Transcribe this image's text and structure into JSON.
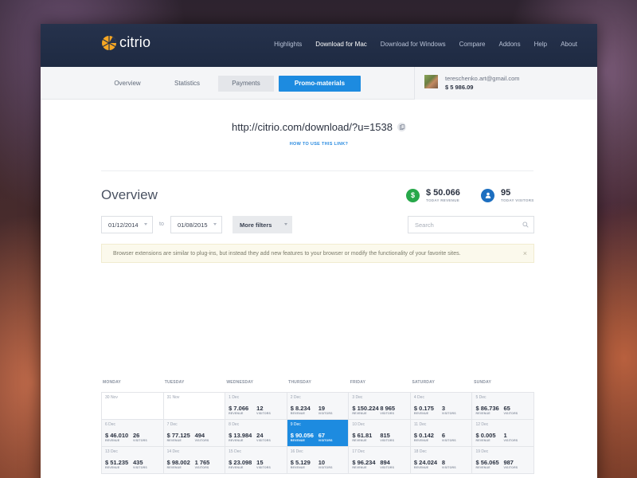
{
  "brand": {
    "name": "citrio",
    "logo_color": "#f5a623"
  },
  "nav": {
    "items": [
      {
        "label": "Highlights",
        "active": false
      },
      {
        "label": "Download for Mac",
        "active": true
      },
      {
        "label": "Download for Windows",
        "active": false
      },
      {
        "label": "Compare",
        "active": false
      },
      {
        "label": "Addons",
        "active": false
      },
      {
        "label": "Help",
        "active": false
      },
      {
        "label": "About",
        "active": false
      }
    ]
  },
  "tabs": [
    {
      "label": "Overview"
    },
    {
      "label": "Statistics"
    },
    {
      "label": "Payments"
    },
    {
      "label": "Promo-materials",
      "active": true
    }
  ],
  "account": {
    "email": "tereschenko.art@gmail.com",
    "balance": "$ 5 986.09"
  },
  "referral": {
    "link": "http://citrio.com/download/?u=1538",
    "howto": "HOW TO USE THIS LINK?"
  },
  "overview": {
    "title": "Overview",
    "revenue": {
      "value": "$ 50.066",
      "label": "TODAY REVENUE",
      "icon": "dollar-icon",
      "color": "#27a84a"
    },
    "visitors": {
      "value": "95",
      "label": "TODAY VISITORS",
      "icon": "user-icon",
      "color": "#1d6fc0"
    }
  },
  "filters": {
    "date_from": "01/12/2014",
    "to_label": "to",
    "date_to": "01/08/2015",
    "more_filters": "More filters",
    "search_placeholder": "Search"
  },
  "notice": {
    "text": "Browser extensions are similar to plug-ins, but instead they add new features to your browser or modify the functionality of your favorite sites.",
    "close": "×"
  },
  "calendar": {
    "days": [
      "MONDAY",
      "TUESDAY",
      "WEDNESDAY",
      "THURSDAY",
      "FRIDAY",
      "SATURDAY",
      "SUNDAY"
    ],
    "revenue_label": "REVENUE",
    "visitors_label": "VISITORS",
    "rows": [
      [
        {
          "date": "30 Nov",
          "muted": true
        },
        {
          "date": "31 Nov",
          "muted": true
        },
        {
          "date": "1 Dec",
          "revenue": "$ 7.066",
          "visitors": "12"
        },
        {
          "date": "2 Dec",
          "revenue": "$ 8.234",
          "visitors": "19"
        },
        {
          "date": "3 Dec",
          "revenue": "$ 150.224",
          "visitors": "8 965"
        },
        {
          "date": "4 Dec",
          "revenue": "$ 0.175",
          "visitors": "3"
        },
        {
          "date": "5 Dec",
          "revenue": "$ 86.736",
          "visitors": "65"
        }
      ],
      [
        {
          "date": "6 Dec",
          "revenue": "$ 46.010",
          "visitors": "26"
        },
        {
          "date": "7 Dec",
          "revenue": "$ 77.125",
          "visitors": "494"
        },
        {
          "date": "8 Dec",
          "revenue": "$ 13.984",
          "visitors": "24"
        },
        {
          "date": "9 Dec",
          "revenue": "$ 90.056",
          "visitors": "67",
          "selected": true
        },
        {
          "date": "10 Dec",
          "revenue": "$ 61.81",
          "visitors": "815"
        },
        {
          "date": "11 Dec",
          "revenue": "$ 0.142",
          "visitors": "6"
        },
        {
          "date": "12 Dec",
          "revenue": "$ 0.005",
          "visitors": "1"
        }
      ],
      [
        {
          "date": "13 Dec",
          "revenue": "$ 51.235",
          "visitors": "435"
        },
        {
          "date": "14 Dec",
          "revenue": "$ 98.002",
          "visitors": "1 765"
        },
        {
          "date": "15 Dec",
          "revenue": "$ 23.098",
          "visitors": "15"
        },
        {
          "date": "16 Dec",
          "revenue": "$ 5.129",
          "visitors": "10"
        },
        {
          "date": "17 Dec",
          "revenue": "$ 96.234",
          "visitors": "894"
        },
        {
          "date": "18 Dec",
          "revenue": "$ 24.024",
          "visitors": "8"
        },
        {
          "date": "19 Dec",
          "revenue": "$ 56.065",
          "visitors": "987"
        }
      ]
    ]
  }
}
